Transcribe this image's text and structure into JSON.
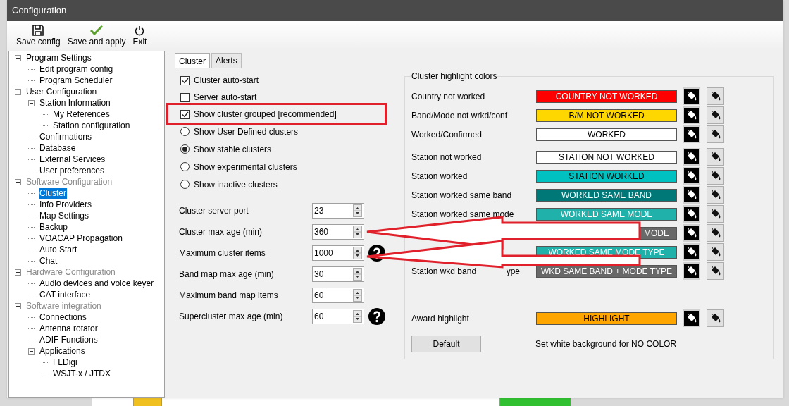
{
  "window": {
    "title": "Configuration"
  },
  "toolbar": [
    {
      "kind": "save",
      "label": "Save config"
    },
    {
      "kind": "apply",
      "label": "Save and apply"
    },
    {
      "kind": "exit",
      "label": "Exit"
    }
  ],
  "tree": [
    {
      "label": "Program Settings",
      "grayed": false,
      "selected": false,
      "expanded": true,
      "children": [
        {
          "label": "Edit program config",
          "grayed": false,
          "selected": false
        },
        {
          "label": "Program Scheduler",
          "grayed": false,
          "selected": false
        }
      ]
    },
    {
      "label": "User Configuration",
      "grayed": false,
      "selected": false,
      "expanded": true,
      "children": [
        {
          "label": "Station Information",
          "grayed": false,
          "selected": false,
          "expanded": true,
          "children": [
            {
              "label": "My References",
              "grayed": false,
              "selected": false
            },
            {
              "label": "Station configuration",
              "grayed": false,
              "selected": false
            }
          ]
        },
        {
          "label": "Confirmations",
          "grayed": false,
          "selected": false
        },
        {
          "label": "Database",
          "grayed": false,
          "selected": false
        },
        {
          "label": "External Services",
          "grayed": false,
          "selected": false
        },
        {
          "label": "User preferences",
          "grayed": false,
          "selected": false
        }
      ]
    },
    {
      "label": "Software Configuration",
      "grayed": true,
      "selected": false,
      "expanded": true,
      "children": [
        {
          "label": "Cluster",
          "grayed": false,
          "selected": true
        },
        {
          "label": "Info Providers",
          "grayed": false,
          "selected": false
        },
        {
          "label": "Map Settings",
          "grayed": false,
          "selected": false
        },
        {
          "label": "Backup",
          "grayed": false,
          "selected": false
        },
        {
          "label": "VOACAP Propagation",
          "grayed": false,
          "selected": false
        },
        {
          "label": "Auto Start",
          "grayed": false,
          "selected": false
        },
        {
          "label": "Chat",
          "grayed": false,
          "selected": false
        }
      ]
    },
    {
      "label": "Hardware Configuration",
      "grayed": true,
      "selected": false,
      "expanded": true,
      "children": [
        {
          "label": "Audio devices and voice keyer",
          "grayed": false,
          "selected": false
        },
        {
          "label": "CAT interface",
          "grayed": false,
          "selected": false
        }
      ]
    },
    {
      "label": "Software integration",
      "grayed": true,
      "selected": false,
      "expanded": true,
      "children": [
        {
          "label": "Connections",
          "grayed": false,
          "selected": false
        },
        {
          "label": "Antenna rotator",
          "grayed": false,
          "selected": false
        },
        {
          "label": "ADIF Functions",
          "grayed": false,
          "selected": false
        },
        {
          "label": "Applications",
          "grayed": false,
          "selected": false,
          "expanded": true,
          "children": [
            {
              "label": "FLDigi",
              "grayed": false,
              "selected": false
            },
            {
              "label": "WSJT-x / JTDX",
              "grayed": false,
              "selected": false
            }
          ]
        }
      ]
    }
  ],
  "tabs": [
    {
      "label": "Cluster",
      "selected": true
    },
    {
      "label": "Alerts",
      "selected": false
    }
  ],
  "checkboxes": [
    {
      "label": "Cluster auto-start",
      "checked": true,
      "highlighted": false
    },
    {
      "label": "Server auto-start",
      "checked": false,
      "highlighted": false
    },
    {
      "label": "Show cluster grouped [recommended]",
      "checked": true,
      "highlighted": true
    }
  ],
  "radios": [
    {
      "label": "Show User Defined clusters",
      "selected": false
    },
    {
      "label": "Show stable clusters",
      "selected": true
    },
    {
      "label": "Show experimental clusters",
      "selected": false
    },
    {
      "label": "Show inactive clusters",
      "selected": false
    }
  ],
  "spin_fields": [
    {
      "label": "Cluster server port",
      "value": "23",
      "help": false,
      "arrowed": false
    },
    {
      "label": "Cluster max age (min)",
      "value": "360",
      "help": false,
      "arrowed": true
    },
    {
      "label": "Maximum cluster items",
      "value": "1000",
      "help": true,
      "arrowed": true
    },
    {
      "label": "Band map max age (min)",
      "value": "30",
      "help": false,
      "arrowed": false
    },
    {
      "label": "Maximum band map items",
      "value": "60",
      "help": false,
      "arrowed": false
    },
    {
      "label": "Supercluster max age (min)",
      "value": "60",
      "help": true,
      "arrowed": false
    }
  ],
  "highlight_colors": {
    "title": "Cluster highlight colors",
    "rows": [
      {
        "label": "Country not worked",
        "text": "COUNTRY NOT WORKED",
        "color": "#ff0000",
        "light_text": true
      },
      {
        "label": "Band/Mode not wrkd/conf",
        "text": "B/M NOT WORKED",
        "color": "#ffd700",
        "light_text": false
      },
      {
        "label": "Worked/Confirmed",
        "text": "WORKED",
        "color": "#ffffff",
        "light_text": false
      },
      {
        "label": "Station not worked",
        "text": "STATION NOT WORKED",
        "color": "#ffffff",
        "light_text": false
      },
      {
        "label": "Station worked",
        "text": "STATION WORKED",
        "color": "#00c0c0",
        "light_text": false
      },
      {
        "label": "Station worked same band",
        "text": "WORKED SAME BAND",
        "color": "#007878",
        "light_text": true
      },
      {
        "label": "Station worked same mode",
        "text": "WORKED SAME MODE",
        "color": "#20b2aa",
        "light_text": true
      },
      {
        "text": "MODE",
        "partly_covered": true,
        "color": "#686868",
        "light_text": true
      },
      {
        "text": "WORKED SAME MODE TYPE",
        "color": "#20b2aa",
        "light_text": true
      },
      {
        "label": "Station wkd band",
        "label_end": "ype",
        "text": "WKD SAME BAND + MODE TYPE",
        "color": "#686868",
        "light_text": true
      }
    ],
    "award": {
      "label": "Award highlight",
      "text": "HIGHLIGHT",
      "color": "#ffa500",
      "light_text": false
    },
    "default_button": "Default",
    "note": "Set white background for NO COLOR"
  }
}
